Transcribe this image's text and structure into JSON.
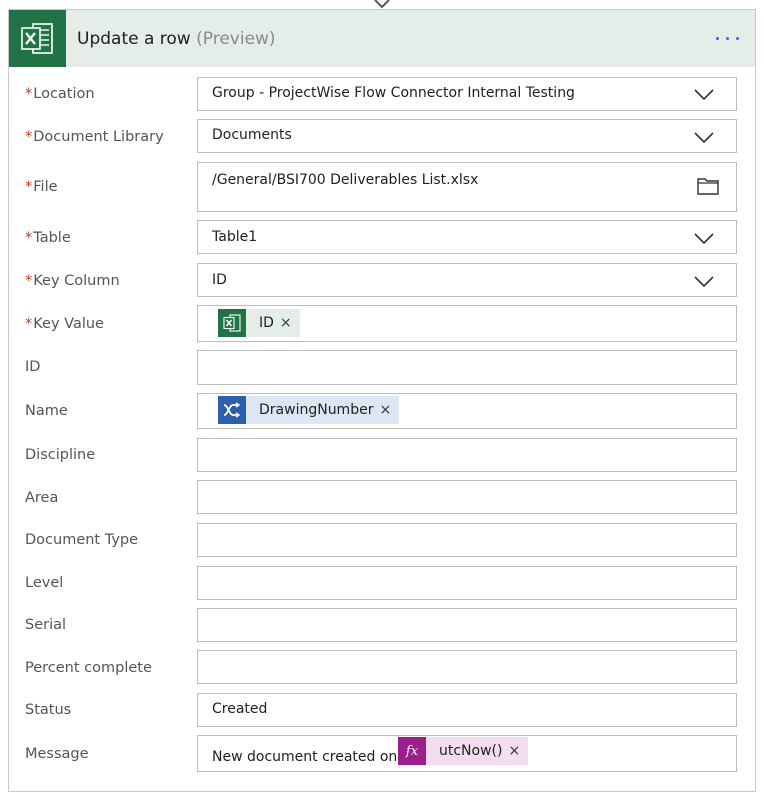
{
  "header": {
    "title": "Update a row",
    "preview": "(Preview)",
    "accent": "#217346",
    "background": "#e4ede7",
    "app_icon": "excel-icon",
    "more_icon": "more-options-icon"
  },
  "fields": {
    "location": {
      "label": "Location",
      "required": "*",
      "value": "Group - ProjectWise Flow Connector Internal Testing"
    },
    "document_library": {
      "label": "Document Library",
      "required": "*",
      "value": "Documents"
    },
    "file": {
      "label": "File",
      "required": "*",
      "value": "/General/BSI700 Deliverables List.xlsx"
    },
    "table": {
      "label": "Table",
      "required": "*",
      "value": "Table1"
    },
    "key_column": {
      "label": "Key Column",
      "required": "*",
      "value": "ID"
    },
    "key_value": {
      "label": "Key Value",
      "required": "*",
      "token": {
        "label": "ID",
        "remove": "×",
        "icon": "excel-icon",
        "color": "#217346",
        "bg": "#e4ede7"
      }
    },
    "id": {
      "label": "ID",
      "value": ""
    },
    "name": {
      "label": "Name",
      "token": {
        "label": "DrawingNumber",
        "remove": "×",
        "icon": "variable-icon",
        "color": "#2e5fad",
        "bg": "#dde6f3"
      }
    },
    "discipline": {
      "label": "Discipline",
      "value": ""
    },
    "area": {
      "label": "Area",
      "value": ""
    },
    "document_type": {
      "label": "Document Type",
      "value": ""
    },
    "level": {
      "label": "Level",
      "value": ""
    },
    "serial": {
      "label": "Serial",
      "value": ""
    },
    "percent_complete": {
      "label": "Percent complete",
      "value": ""
    },
    "status": {
      "label": "Status",
      "value": "Created"
    },
    "message": {
      "label": "Message",
      "value": "New document created on",
      "token": {
        "label": "utcNow()",
        "remove": "×",
        "icon": "function-icon",
        "icon_text": "fx",
        "color": "#9c1f8c",
        "bg": "#f3ddef"
      }
    }
  }
}
